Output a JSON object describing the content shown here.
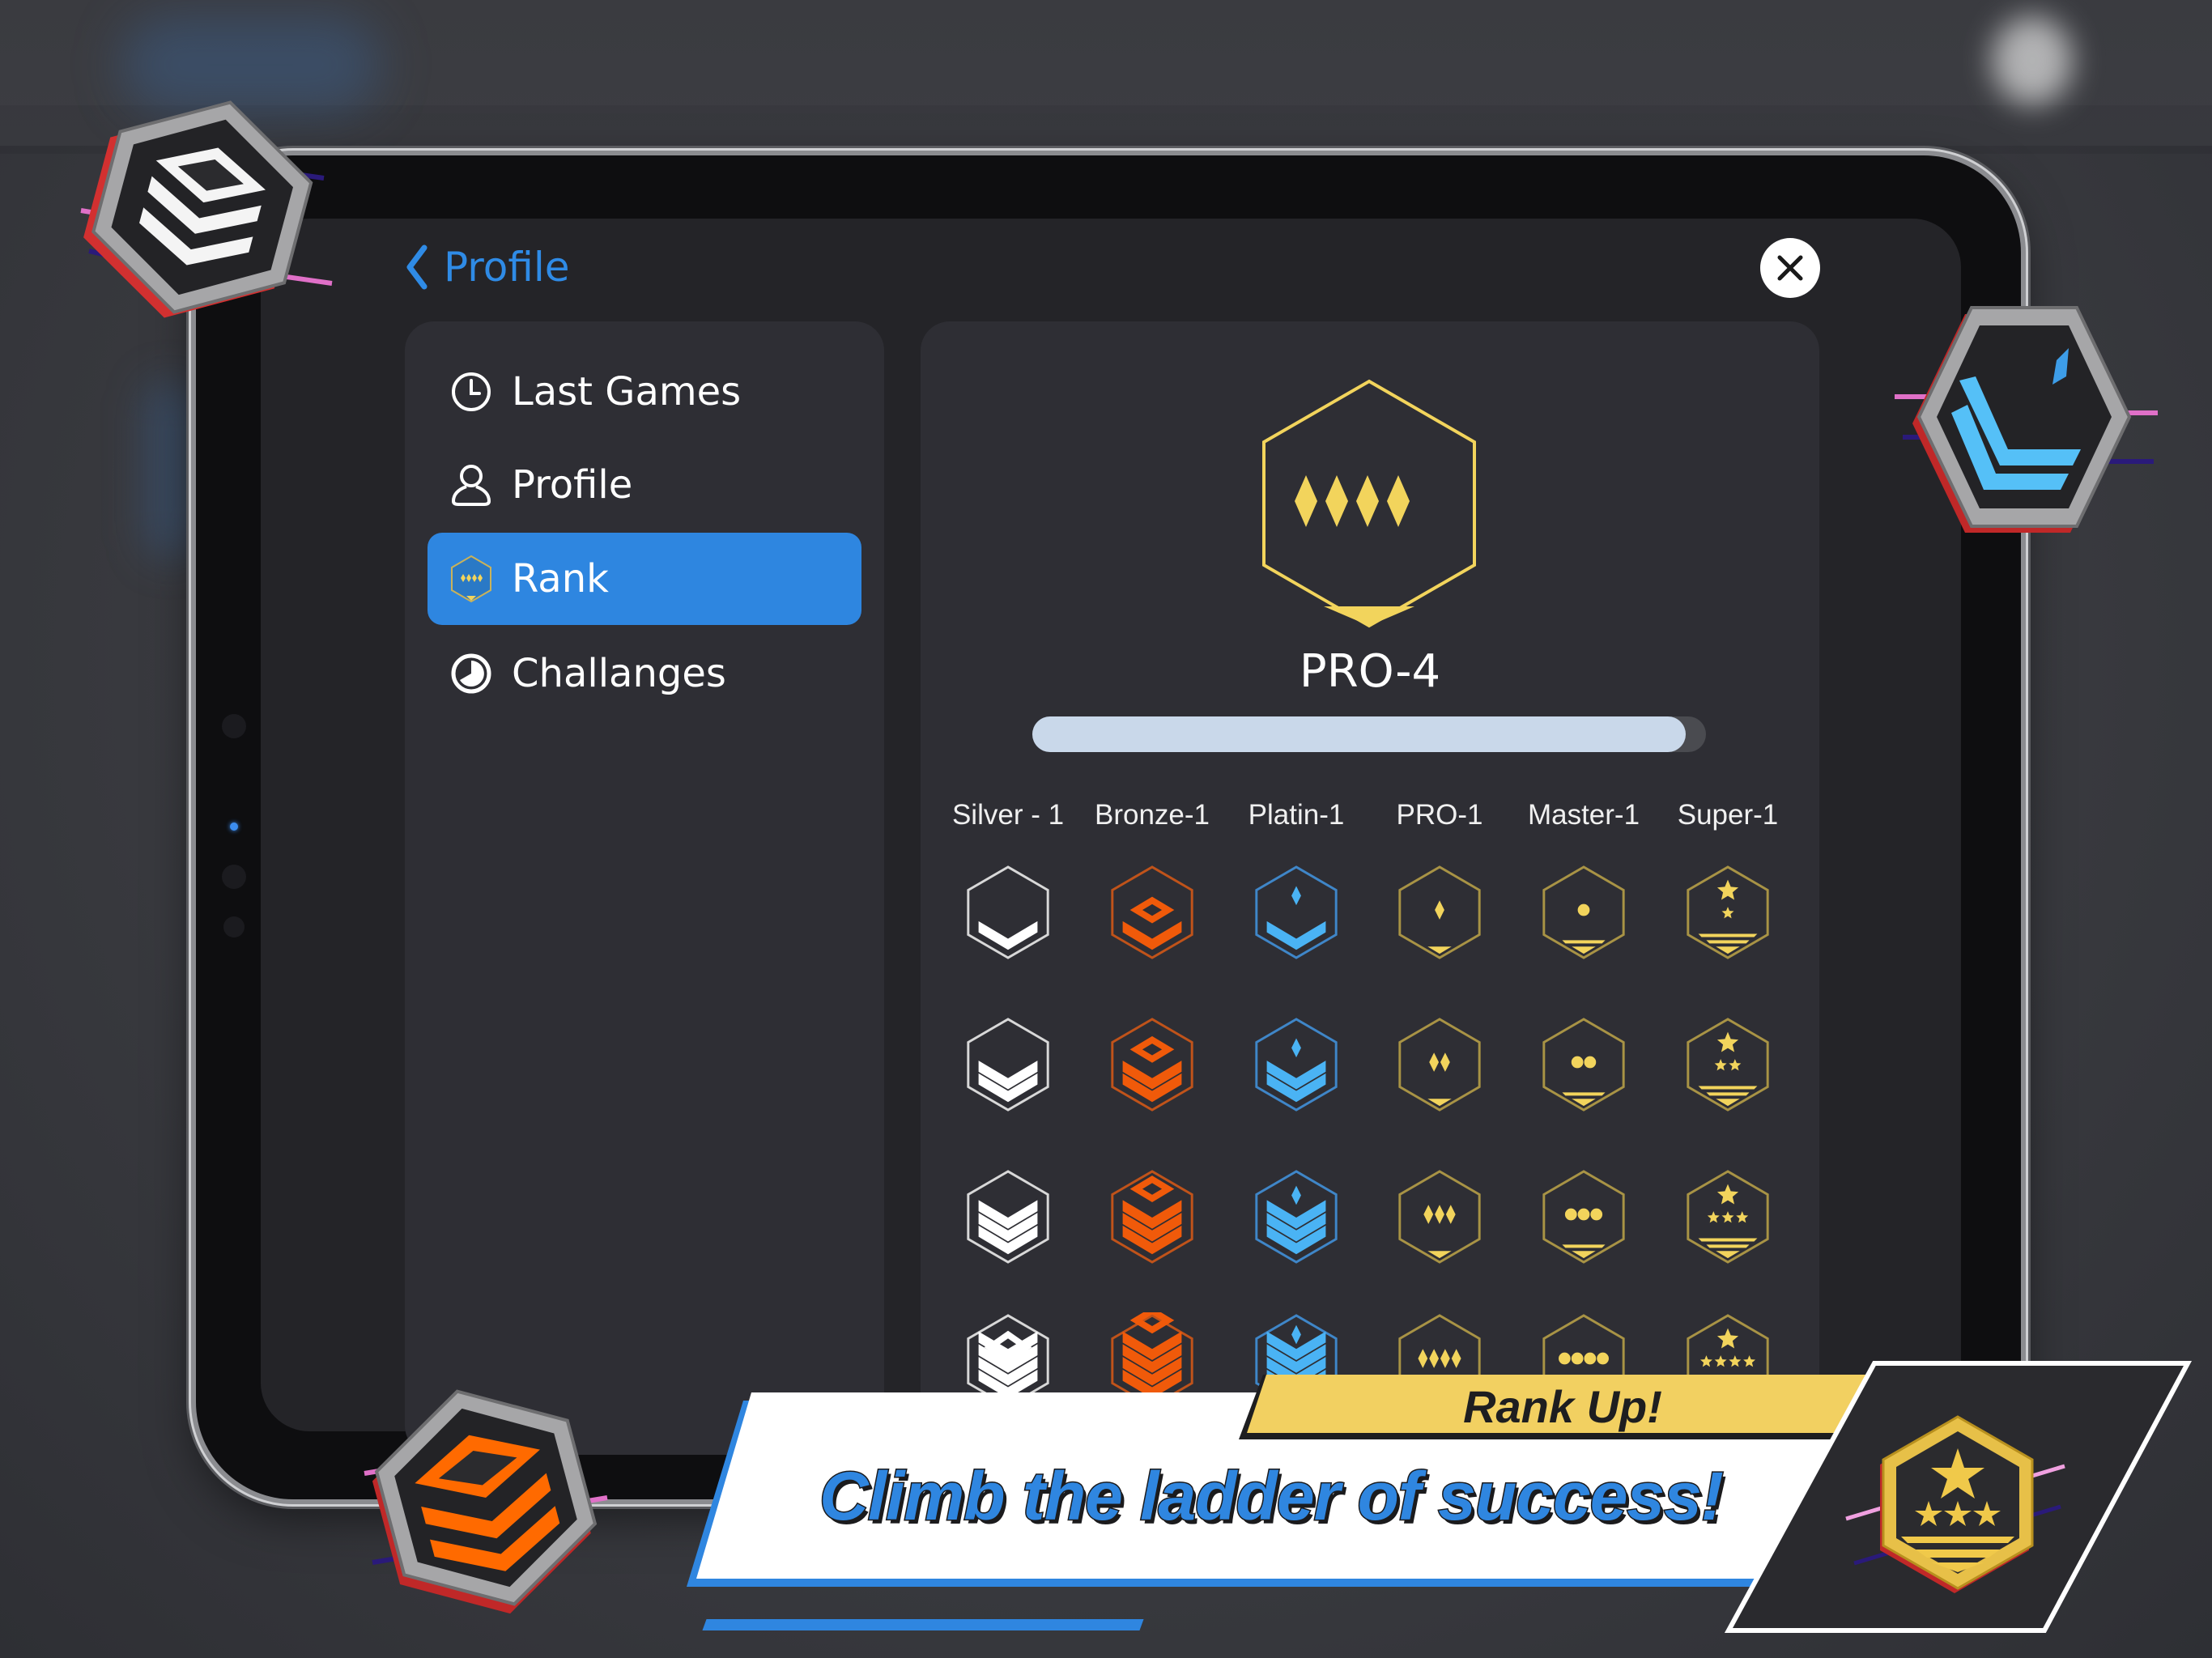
{
  "header": {
    "back_label": "Profile",
    "back_icon": "chevron-left-icon",
    "close_icon": "close-icon"
  },
  "sidebar": {
    "items": [
      {
        "label": "Last Games",
        "icon": "clock-icon",
        "active": false
      },
      {
        "label": "Profile",
        "icon": "user-icon",
        "active": false
      },
      {
        "label": "Rank",
        "icon": "rank-badge-icon",
        "active": true
      },
      {
        "label": "Challanges",
        "icon": "pie-timer-icon",
        "active": false
      }
    ]
  },
  "rank": {
    "current": "PRO-4",
    "progress_percent": 97,
    "columns": [
      "Silver - 1",
      "Bronze-1",
      "Platin-1",
      "PRO-1",
      "Master-1",
      "Super-1"
    ],
    "tiers": [
      {
        "name": "silver",
        "color": "#ffffff",
        "outline": "#d8d8d8",
        "symbol": "chevron"
      },
      {
        "name": "bronze",
        "color": "#f05a0a",
        "outline": "#c0531a",
        "symbol": "bronze-chevron"
      },
      {
        "name": "platin",
        "color": "#4ab3f4",
        "outline": "#3f86c8",
        "symbol": "platin-chevron"
      },
      {
        "name": "pro",
        "color": "#f2d45c",
        "outline": "#a89345",
        "symbol": "diamond"
      },
      {
        "name": "master",
        "color": "#f2d45c",
        "outline": "#a89345",
        "symbol": "dot"
      },
      {
        "name": "super",
        "color": "#f2d45c",
        "outline": "#a89345",
        "symbol": "star"
      }
    ],
    "levels_visible": 4
  },
  "banner": {
    "tag": "Rank Up!",
    "slogan": "Climb the ladder of success!"
  },
  "colors": {
    "accent_blue": "#2e86e0",
    "gold": "#f2d45c",
    "panel": "#2e2e34",
    "screen_bg": "#242428"
  }
}
